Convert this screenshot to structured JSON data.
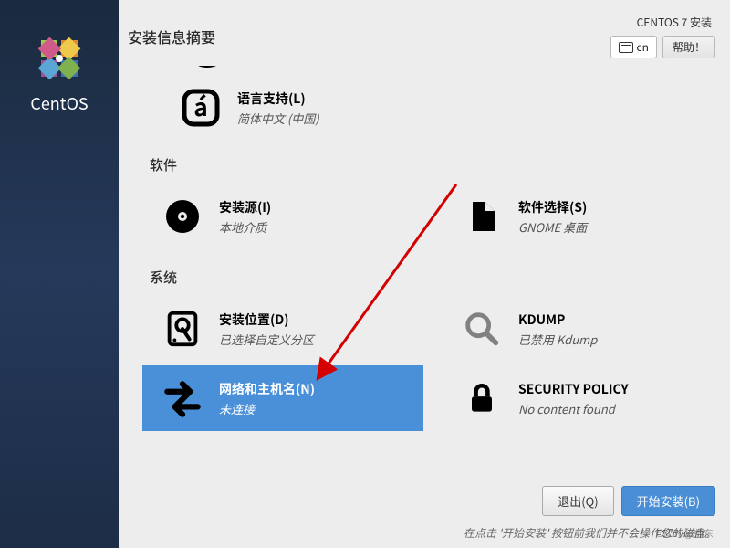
{
  "brand": "CentOS",
  "header": {
    "title": "安装信息摘要",
    "product": "CENTOS 7 安装",
    "keyboard": "cn",
    "help_label": "帮助！"
  },
  "sections": {
    "localization_partial": {
      "language_support": {
        "title": "语言支持(L)",
        "sub": "简体中文 (中国)"
      }
    },
    "software": {
      "heading": "软件",
      "source": {
        "title": "安装源(I)",
        "sub": "本地介质"
      },
      "selection": {
        "title": "软件选择(S)",
        "sub": "GNOME 桌面"
      }
    },
    "system": {
      "heading": "系统",
      "dest": {
        "title": "安装位置(D)",
        "sub": "已选择自定义分区"
      },
      "kdump": {
        "title": "KDUMP",
        "sub": "已禁用 Kdump"
      },
      "network": {
        "title": "网络和主机名(N)",
        "sub": "未连接"
      },
      "security": {
        "title": "SECURITY POLICY",
        "sub": "No content found"
      }
    }
  },
  "footer": {
    "quit": "退出(Q)",
    "begin": "开始安装(B)",
    "hint": "在点击 '开始安装' 按钮前我们并不会操作您的磁盘。"
  },
  "watermark": "CSDN @帅东"
}
